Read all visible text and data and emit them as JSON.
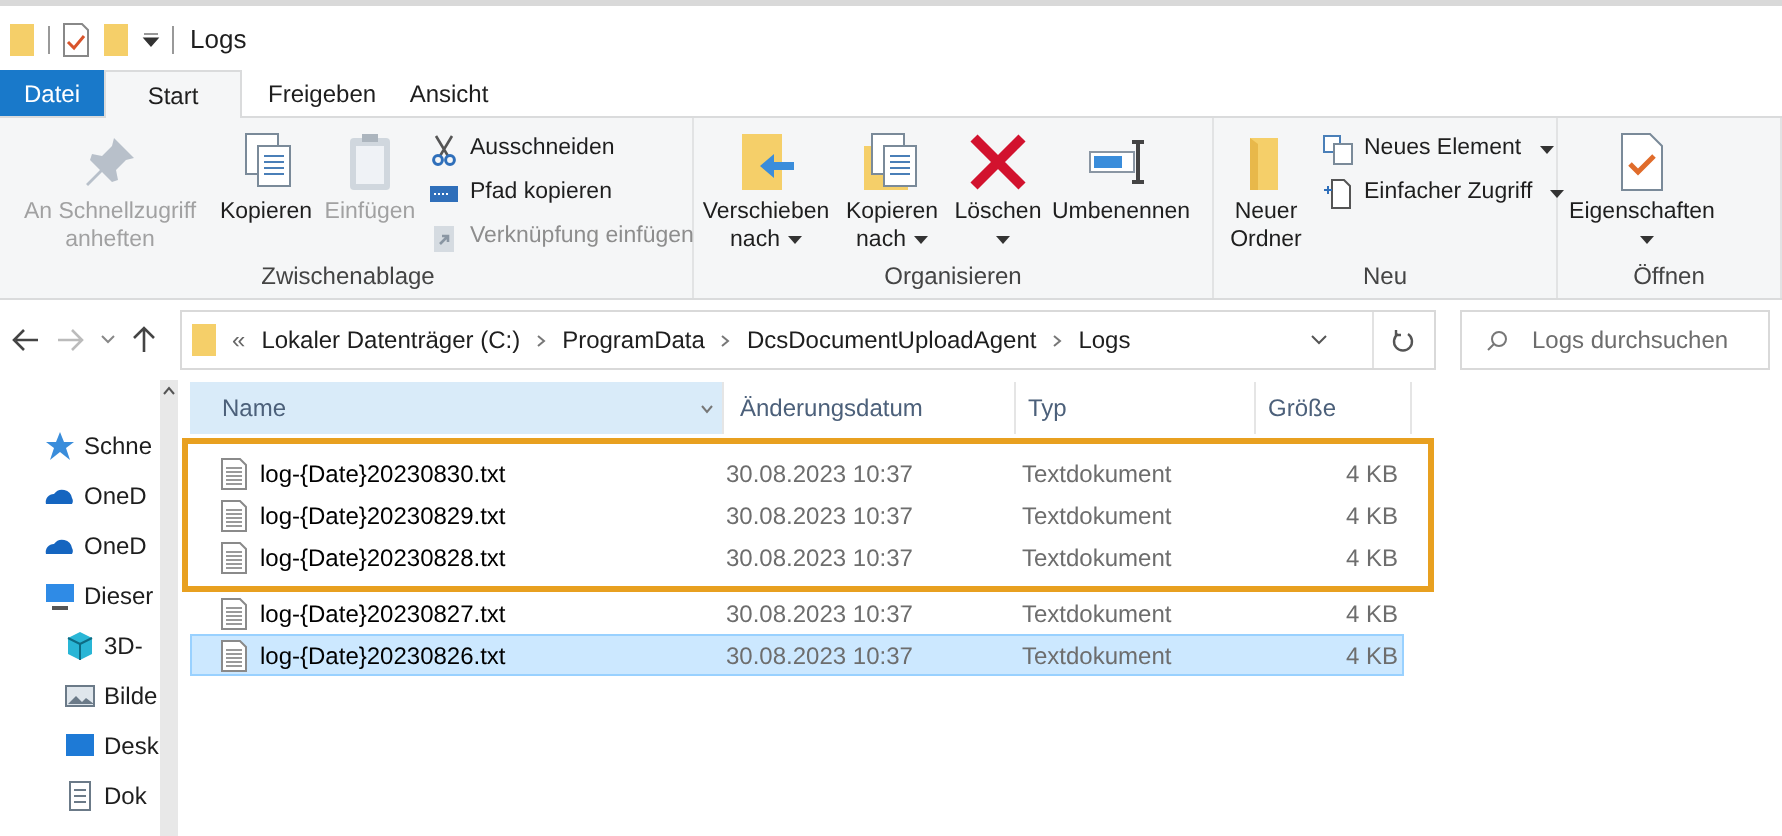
{
  "window": {
    "title": "Logs"
  },
  "tabs": [
    {
      "label": "Datei",
      "kind": "file",
      "selected": false
    },
    {
      "label": "Start",
      "kind": "tab",
      "selected": true
    },
    {
      "label": "Freigeben",
      "kind": "tab",
      "selected": false
    },
    {
      "label": "Ansicht",
      "kind": "tab",
      "selected": false
    }
  ],
  "ribbon_groups": [
    {
      "label": "Zwischenablage",
      "items": [
        {
          "kind": "large",
          "label": "An Schnellzugriff anheften",
          "disabled": true,
          "dropdown": false
        },
        {
          "kind": "large",
          "label": "Kopieren",
          "disabled": false,
          "dropdown": false
        },
        {
          "kind": "large",
          "label": "Einfügen",
          "disabled": true,
          "dropdown": false
        },
        {
          "kind": "stack",
          "items": [
            {
              "label": "Ausschneiden",
              "disabled": false,
              "dropdown": false
            },
            {
              "label": "Pfad kopieren",
              "disabled": false,
              "dropdown": false
            },
            {
              "label": "Verknüpfung einfügen",
              "disabled": true,
              "dropdown": false
            }
          ]
        }
      ]
    },
    {
      "label": "Organisieren",
      "items": [
        {
          "kind": "large",
          "label": "Verschieben nach",
          "disabled": false,
          "dropdown": true
        },
        {
          "kind": "large",
          "label": "Kopieren nach",
          "disabled": false,
          "dropdown": true
        },
        {
          "kind": "large",
          "label": "Löschen",
          "disabled": false,
          "dropdown": true
        },
        {
          "kind": "large",
          "label": "Umbenennen",
          "disabled": false,
          "dropdown": false
        }
      ]
    },
    {
      "label": "Neu",
      "items": [
        {
          "kind": "large",
          "label": "Neuer Ordner",
          "disabled": false,
          "dropdown": false
        },
        {
          "kind": "stack",
          "items": [
            {
              "label": "Neues Element",
              "disabled": false,
              "dropdown": true
            },
            {
              "label": "Einfacher Zugriff",
              "disabled": false,
              "dropdown": true
            }
          ]
        }
      ]
    },
    {
      "label": "Öffnen",
      "items": [
        {
          "kind": "large",
          "label": "Eigenschaften",
          "disabled": false,
          "dropdown": true
        }
      ]
    }
  ],
  "address": {
    "overflow": "«",
    "path": [
      "Lokaler Datenträger (C:)",
      "ProgramData",
      "DcsDocumentUploadAgent",
      "Logs"
    ]
  },
  "search": {
    "placeholder": "Logs durchsuchen"
  },
  "sidebar": {
    "items": [
      {
        "label": "Schne"
      },
      {
        "label": "OneD"
      },
      {
        "label": "OneD"
      },
      {
        "label": "Dieser",
        "children": [
          {
            "label": "3D-"
          },
          {
            "label": "Bilde"
          },
          {
            "label": "Desk"
          },
          {
            "label": "Dok"
          }
        ]
      }
    ]
  },
  "table": {
    "columns": [
      "Name",
      "Änderungsdatum",
      "Typ",
      "Größe"
    ],
    "rows": [
      {
        "name": "log-{Date}20230830.txt",
        "date": "30.08.2023 10:37",
        "type": "Textdokument",
        "size": "4 KB",
        "selected": false,
        "highlighted": true
      },
      {
        "name": "log-{Date}20230829.txt",
        "date": "30.08.2023 10:37",
        "type": "Textdokument",
        "size": "4 KB",
        "selected": false,
        "highlighted": true
      },
      {
        "name": "log-{Date}20230828.txt",
        "date": "30.08.2023 10:37",
        "type": "Textdokument",
        "size": "4 KB",
        "selected": false,
        "highlighted": true
      },
      {
        "name": "log-{Date}20230827.txt",
        "date": "30.08.2023 10:37",
        "type": "Textdokument",
        "size": "4 KB",
        "selected": false,
        "highlighted": false
      },
      {
        "name": "log-{Date}20230826.txt",
        "date": "30.08.2023 10:37",
        "type": "Textdokument",
        "size": "4 KB",
        "selected": true,
        "highlighted": false
      }
    ]
  }
}
